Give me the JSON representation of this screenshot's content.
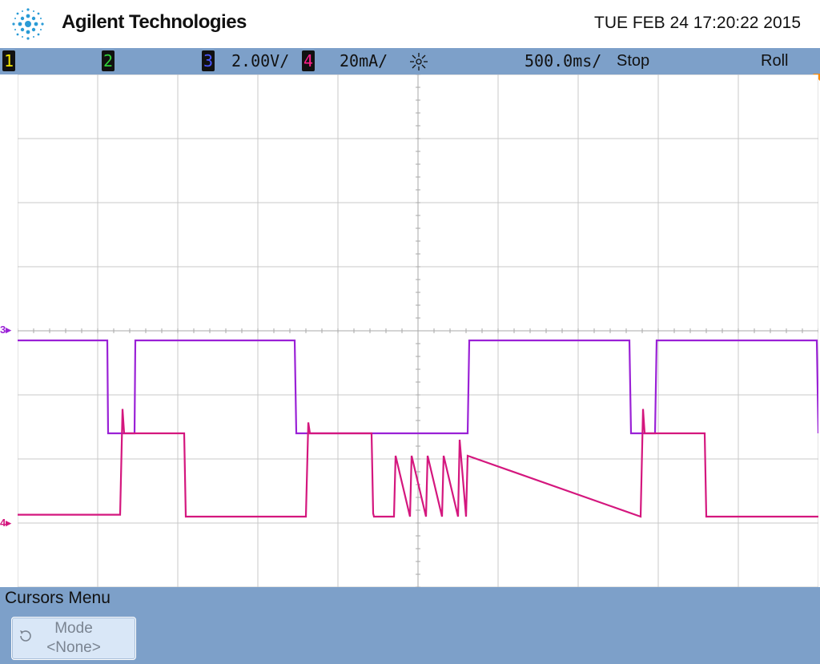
{
  "header": {
    "brand": "Agilent Technologies",
    "datetime": "TUE FEB 24 17:20:22 2015"
  },
  "status": {
    "ch1_label": "1",
    "ch2_label": "2",
    "ch3_label": "3",
    "ch3_scale": "2.00V/",
    "ch4_label": "4",
    "ch4_scale": "20mA/",
    "timebase": "500.0ms/",
    "run_state": "Stop",
    "mode": "Roll"
  },
  "markers": {
    "ch3_ground": "3",
    "ch4_ground": "4"
  },
  "menu": {
    "title": "Cursors Menu",
    "softkey_label": "Mode",
    "softkey_value": "<None>"
  },
  "colors": {
    "ch1": "#f2e600",
    "ch2": "#2fd13a",
    "ch3": "#9a21d6",
    "ch4": "#d4177e",
    "bar": "#7da0c9"
  },
  "chart_data": {
    "type": "line",
    "grid": true,
    "x_divisions": 10,
    "y_divisions": 8,
    "series": [
      {
        "name": "3",
        "units": "div",
        "x": [
          0,
          1.12,
          1.13,
          1.46,
          1.47,
          3.46,
          3.48,
          5.62,
          5.64,
          7.64,
          7.66,
          7.96,
          7.98,
          9.98,
          10
        ],
        "y": [
          1.45,
          1.45,
          0,
          0,
          1.45,
          1.45,
          0,
          0,
          1.45,
          1.45,
          0,
          0,
          1.45,
          1.45,
          0
        ]
      },
      {
        "name": "4",
        "units": "div",
        "x": [
          0,
          1.28,
          1.31,
          1.33,
          2.08,
          2.1,
          3.6,
          3.63,
          3.65,
          4.42,
          4.44,
          4.45,
          4.7,
          4.72,
          4.9,
          4.92,
          5.1,
          5.12,
          5.3,
          5.32,
          5.5,
          5.52,
          5.6,
          5.62,
          7.78,
          7.81,
          7.83,
          8.58,
          8.6,
          10
        ],
        "y": [
          0.18,
          0.18,
          1.83,
          1.45,
          1.45,
          0.15,
          0.15,
          1.62,
          1.45,
          1.45,
          0.2,
          0.15,
          0.15,
          1.1,
          0.15,
          1.1,
          0.15,
          1.1,
          0.15,
          1.1,
          0.15,
          1.35,
          0.15,
          1.1,
          0.15,
          1.83,
          1.45,
          1.45,
          0.15,
          0.15
        ]
      }
    ]
  }
}
